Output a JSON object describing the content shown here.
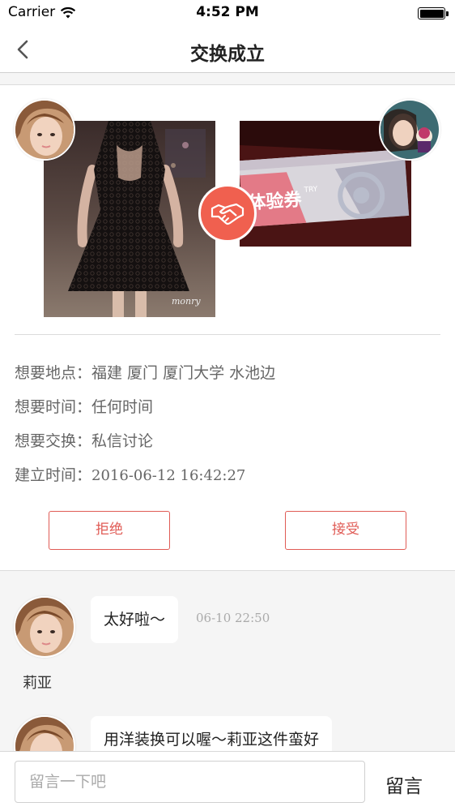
{
  "status_bar": {
    "carrier": "Carrier",
    "time": "4:52 PM"
  },
  "nav": {
    "title": "交换成立",
    "back_icon": "chevron-left-icon"
  },
  "exchange": {
    "left_user_avatar": "avatar-photo",
    "right_user_avatar": "avatar-photo",
    "left_item_image": "black-lace-dress-photo",
    "right_item_image": "voucher-card-photo",
    "right_item_text": "体验券",
    "right_item_sup": "TRY",
    "right_item_watermark": "monry",
    "swap_icon": "handshake-icon",
    "accent_color": "#f0604f"
  },
  "details": [
    {
      "label": "想要地点：",
      "value": "福建 厦门 厦门大学 水池边"
    },
    {
      "label": "想要时间：",
      "value": "任何时间"
    },
    {
      "label": "想要交换：",
      "value": "私信讨论"
    },
    {
      "label": "建立时间：",
      "value": "2016-06-12 16:42:27"
    }
  ],
  "actions": {
    "reject_label": "拒绝",
    "accept_label": "接受",
    "button_color": "#e05b55"
  },
  "messages": [
    {
      "text": "太好啦～",
      "time": "06-10 22:50",
      "sender": "莉亚"
    },
    {
      "text": "用洋装换可以喔～莉亚这件蛮好",
      "time": "",
      "sender": ""
    }
  ],
  "composer": {
    "placeholder": "留言一下吧",
    "value": "",
    "send_label": "留言"
  }
}
